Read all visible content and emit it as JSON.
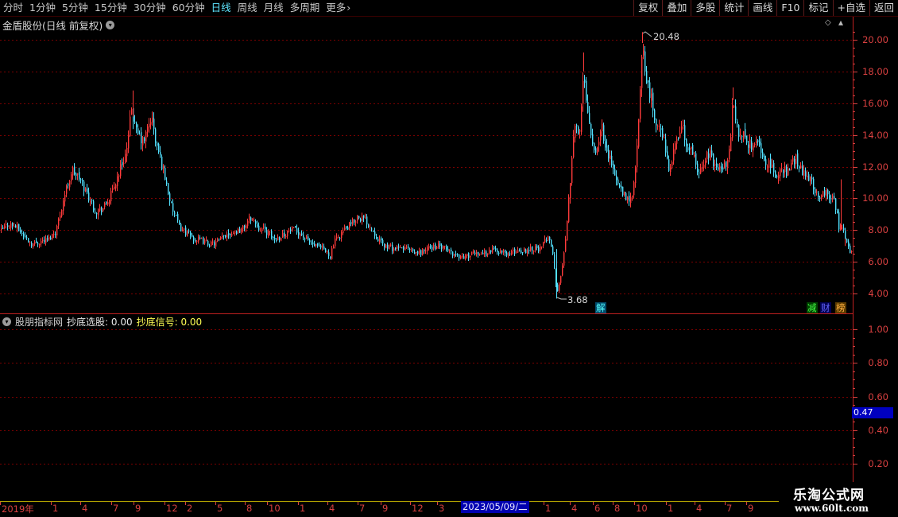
{
  "toolbar": {
    "periods": [
      "分时",
      "1分钟",
      "5分钟",
      "15分钟",
      "30分钟",
      "60分钟",
      "日线",
      "周线",
      "月线",
      "多周期",
      "更多"
    ],
    "active_period": "日线",
    "tools": [
      "复权",
      "叠加",
      "多股",
      "统计",
      "画线",
      "F10",
      "标记",
      "+自选",
      "返回"
    ]
  },
  "main_chart": {
    "title": "金盾股份(日线 前复权)",
    "high_label": "20.48",
    "low_label": "3.68",
    "y_ticks": [
      "20.00",
      "18.00",
      "16.00",
      "14.00",
      "12.00",
      "10.00",
      "8.00",
      "6.00",
      "4.00"
    ],
    "badges": [
      "解",
      "减",
      "财",
      "榜"
    ],
    "colors": {
      "up": "#ff3b3b",
      "down": "#52e1ff",
      "grid": "#7a0000",
      "axis": "#d84040"
    }
  },
  "indicator": {
    "name": "股朋指标网",
    "label1": "抄底选股: 0.00",
    "label2": "抄底信号: 0.00",
    "y_ticks": [
      "1.00",
      "0.80",
      "0.60",
      "0.40",
      "0.20"
    ],
    "cursor_value": "0.47"
  },
  "time_axis": {
    "labels": [
      "2019年",
      "1",
      "4",
      "7",
      "9",
      "12",
      "2",
      "5",
      "8",
      "10",
      "1",
      "4",
      "7",
      "9",
      "12",
      "3",
      "1",
      "4",
      "6",
      "8",
      "10",
      "1",
      "4",
      "7",
      "9"
    ],
    "cursor_date": "2023/05/09/二"
  },
  "watermark": {
    "name": "乐淘公式网",
    "url": "www.60lt.com"
  },
  "chart_data": {
    "type": "candlestick",
    "y_range": [
      3.2,
      21.0
    ],
    "series": [
      {
        "price_path": [
          [
            0,
            7.9
          ],
          [
            10,
            8.4
          ],
          [
            20,
            8.2
          ],
          [
            30,
            7.6
          ],
          [
            40,
            7.1
          ],
          [
            50,
            7.3
          ],
          [
            60,
            7.4
          ],
          [
            70,
            8.0
          ],
          [
            80,
            10.1
          ],
          [
            90,
            11.8
          ],
          [
            100,
            11.2
          ],
          [
            110,
            10.2
          ],
          [
            120,
            9.2
          ],
          [
            130,
            9.4
          ],
          [
            140,
            10.3
          ],
          [
            150,
            11.8
          ],
          [
            160,
            13.2
          ],
          [
            165,
            15.8
          ],
          [
            170,
            14.2
          ],
          [
            180,
            13.5
          ],
          [
            190,
            15.2
          ],
          [
            195,
            13.6
          ],
          [
            205,
            11.8
          ],
          [
            215,
            9.5
          ],
          [
            225,
            8.2
          ],
          [
            235,
            7.8
          ],
          [
            245,
            7.4
          ],
          [
            255,
            7.3
          ],
          [
            265,
            7.1
          ],
          [
            275,
            7.3
          ],
          [
            285,
            7.8
          ],
          [
            295,
            7.9
          ],
          [
            305,
            8.1
          ],
          [
            315,
            8.8
          ],
          [
            325,
            8.2
          ],
          [
            335,
            7.9
          ],
          [
            345,
            7.4
          ],
          [
            355,
            7.7
          ],
          [
            365,
            8.0
          ],
          [
            375,
            7.9
          ],
          [
            385,
            7.4
          ],
          [
            395,
            7.0
          ],
          [
            405,
            6.8
          ],
          [
            415,
            6.4
          ],
          [
            420,
            7.2
          ],
          [
            430,
            7.9
          ],
          [
            440,
            8.3
          ],
          [
            450,
            8.9
          ],
          [
            460,
            8.6
          ],
          [
            470,
            7.9
          ],
          [
            480,
            7.1
          ],
          [
            490,
            6.9
          ],
          [
            500,
            6.8
          ],
          [
            510,
            6.9
          ],
          [
            520,
            6.5
          ],
          [
            530,
            6.6
          ],
          [
            540,
            6.9
          ],
          [
            550,
            7.0
          ],
          [
            560,
            6.8
          ],
          [
            570,
            6.5
          ],
          [
            580,
            6.3
          ],
          [
            590,
            6.4
          ],
          [
            600,
            6.6
          ],
          [
            610,
            6.5
          ],
          [
            620,
            6.8
          ],
          [
            630,
            6.6
          ],
          [
            640,
            6.5
          ],
          [
            650,
            6.7
          ],
          [
            660,
            6.7
          ],
          [
            670,
            6.9
          ],
          [
            680,
            6.8
          ],
          [
            690,
            7.8
          ],
          [
            696,
            6.1
          ],
          [
            700,
            4.0
          ],
          [
            705,
            5.0
          ],
          [
            712,
            8.0
          ],
          [
            718,
            11.9
          ],
          [
            722,
            15.0
          ],
          [
            728,
            13.6
          ],
          [
            734,
            18.0
          ],
          [
            740,
            15.2
          ],
          [
            748,
            12.8
          ],
          [
            756,
            14.5
          ],
          [
            764,
            13.0
          ],
          [
            772,
            11.6
          ],
          [
            780,
            10.5
          ],
          [
            788,
            9.9
          ],
          [
            796,
            10.1
          ],
          [
            800,
            12.8
          ],
          [
            804,
            15.4
          ],
          [
            808,
            19.8
          ],
          [
            812,
            17.6
          ],
          [
            818,
            16.4
          ],
          [
            826,
            14.6
          ],
          [
            834,
            13.8
          ],
          [
            842,
            11.8
          ],
          [
            850,
            13.4
          ],
          [
            858,
            14.9
          ],
          [
            864,
            12.8
          ],
          [
            870,
            13.2
          ],
          [
            878,
            11.2
          ],
          [
            884,
            12.4
          ],
          [
            892,
            12.8
          ],
          [
            900,
            12.1
          ],
          [
            908,
            12.0
          ],
          [
            916,
            12.2
          ],
          [
            922,
            16.2
          ],
          [
            928,
            14.1
          ],
          [
            936,
            13.9
          ],
          [
            944,
            13.3
          ],
          [
            952,
            13.6
          ],
          [
            960,
            12.6
          ],
          [
            968,
            12.0
          ],
          [
            976,
            11.5
          ],
          [
            984,
            11.8
          ],
          [
            992,
            11.6
          ],
          [
            1000,
            12.6
          ],
          [
            1008,
            11.8
          ],
          [
            1016,
            11.5
          ],
          [
            1022,
            11.0
          ],
          [
            1028,
            10.1
          ],
          [
            1036,
            10.4
          ],
          [
            1044,
            10.1
          ],
          [
            1050,
            9.9
          ],
          [
            1055,
            8.1
          ],
          [
            1060,
            8.0
          ],
          [
            1066,
            6.9
          ],
          [
            1070,
            6.5
          ]
        ]
      }
    ]
  }
}
